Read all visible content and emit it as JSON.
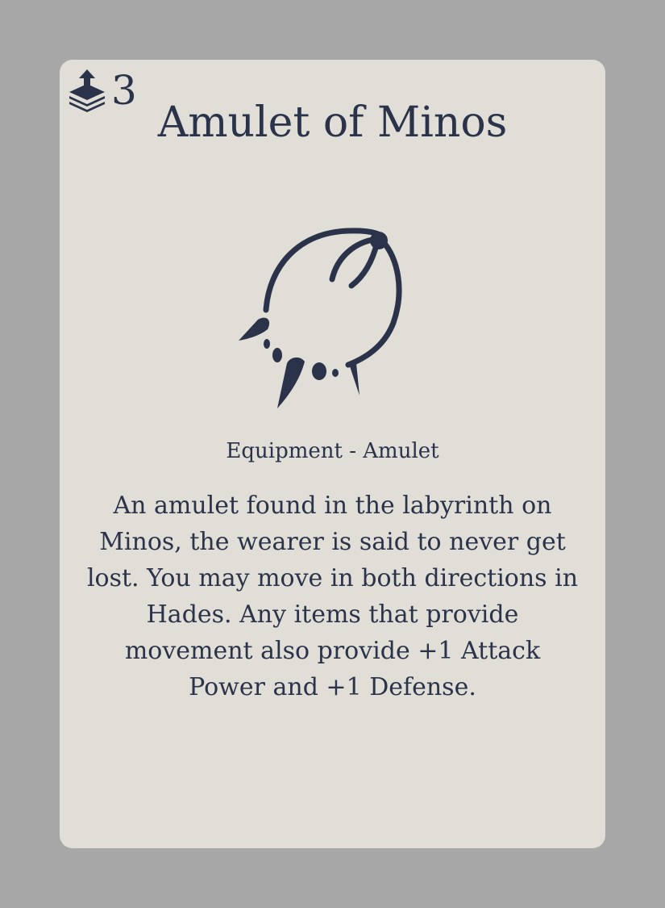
{
  "card": {
    "cost": "3",
    "cost_icon": "card-stack-upload-icon",
    "title": "Amulet of Minos",
    "art_icon": "tooth-necklace-icon",
    "type_line": "Equipment - Amulet",
    "description": "An amulet found in the labyrinth on Minos, the wearer is said to never get lost. You may move in both directions in Hades. Any items that provide movement also provide +1 Attack Power and +1 Defense."
  },
  "colors": {
    "background": "#a7a7a7",
    "card": "#e0ded6",
    "ink": "#2a3349"
  }
}
